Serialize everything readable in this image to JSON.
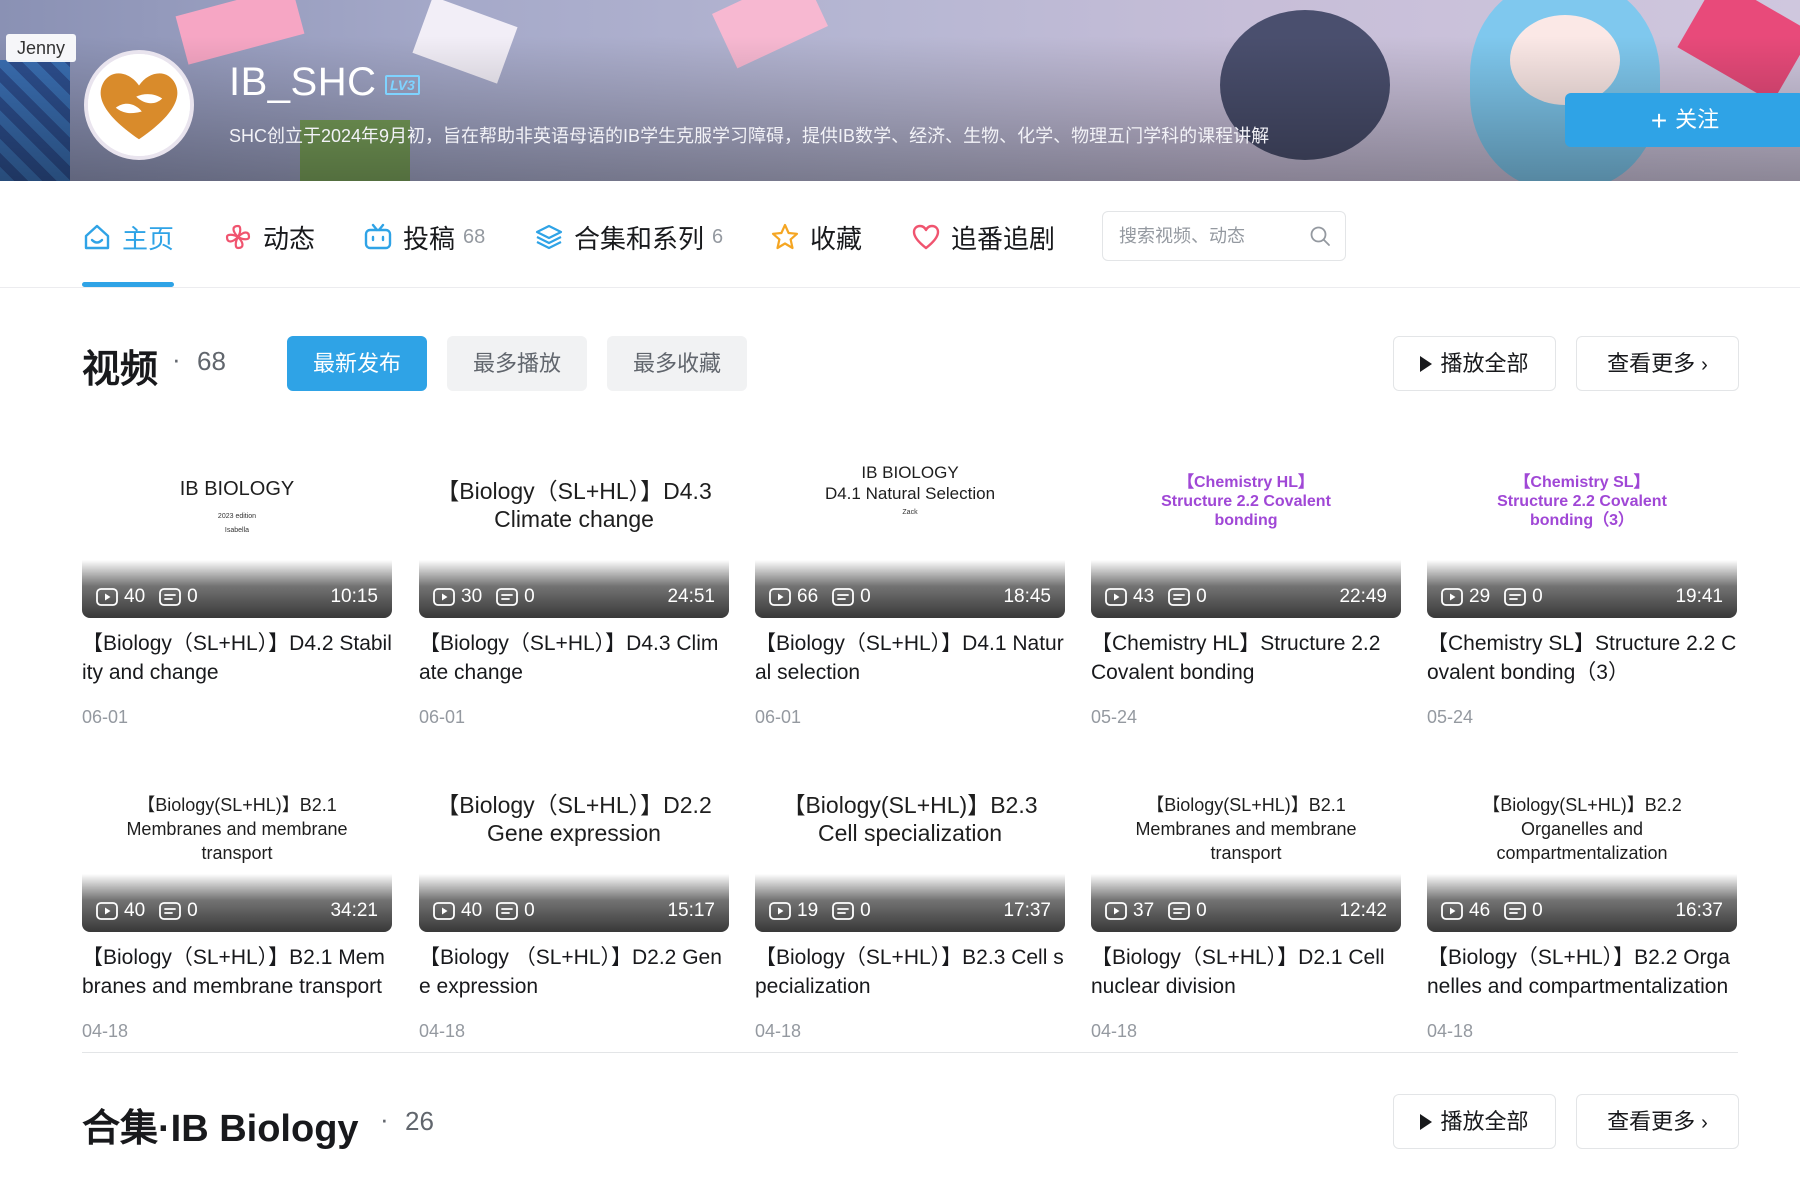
{
  "banner": {
    "badge": "Jenny",
    "username": "IB_SHC",
    "level": "LV3",
    "signature": "SHC创立于2024年9月初，旨在帮助非英语母语的IB学生克服学习障碍，提供IB数学、经济、生物、化学、物理五门学科的课程讲解",
    "follow_label": "关注"
  },
  "nav": {
    "items": [
      {
        "label": "主页",
        "count": ""
      },
      {
        "label": "动态",
        "count": ""
      },
      {
        "label": "投稿",
        "count": "68"
      },
      {
        "label": "合集和系列",
        "count": "6"
      },
      {
        "label": "收藏",
        "count": ""
      },
      {
        "label": "追番追剧",
        "count": ""
      }
    ],
    "search_placeholder": "搜索视频、动态"
  },
  "videos_section": {
    "title": "视频",
    "dot": "·",
    "count": "68",
    "sort": [
      "最新发布",
      "最多播放",
      "最多收藏"
    ],
    "play_all": "播放全部",
    "see_more": "查看更多"
  },
  "videos": [
    {
      "thumb_title": "IB  BIOLOGY",
      "thumb_sub": "2023 edition",
      "thumb_sub2": "Isabella",
      "plays": "40",
      "danmaku": "0",
      "duration": "10:15",
      "title": "【Biology（SL+HL）】D4.2 Stability and change",
      "date": "06-01"
    },
    {
      "thumb_title": "【Biology（SL+HL）】D4.3 Climate change",
      "plays": "30",
      "danmaku": "0",
      "duration": "24:51",
      "title": "【Biology（SL+HL）】D4.3 Climate change",
      "date": "06-01"
    },
    {
      "thumb_title": "IB BIOLOGY",
      "thumb_title2": "D4.1 Natural Selection",
      "thumb_sub": "Zack",
      "plays": "66",
      "danmaku": "0",
      "duration": "18:45",
      "title": "【Biology（SL+HL）】D4.1 Natural selection",
      "date": "06-01"
    },
    {
      "thumb_title": "【Chemistry HL】 Structure 2.2 Covalent bonding",
      "plays": "43",
      "danmaku": "0",
      "duration": "22:49",
      "title": "【Chemistry HL】Structure 2.2 Covalent bonding",
      "date": "05-24"
    },
    {
      "thumb_title": "【Chemistry SL】 Structure 2.2 Covalent bonding（3）",
      "plays": "29",
      "danmaku": "0",
      "duration": "19:41",
      "title": "【Chemistry SL】Structure 2.2 Covalent bonding（3）",
      "date": "05-24"
    },
    {
      "thumb_title": "【Biology(SL+HL)】B2.1 Membranes and membrane transport",
      "plays": "40",
      "danmaku": "0",
      "duration": "34:21",
      "title": "【Biology（SL+HL）】B2.1 Membranes and membrane transport",
      "date": "04-18"
    },
    {
      "thumb_title": "【Biology（SL+HL）】D2.2 Gene expression",
      "plays": "40",
      "danmaku": "0",
      "duration": "15:17",
      "title": "【Biology （SL+HL）】D2.2 Gene expression",
      "date": "04-18"
    },
    {
      "thumb_title": "【Biology(SL+HL)】B2.3 Cell specialization",
      "plays": "19",
      "danmaku": "0",
      "duration": "17:37",
      "title": "【Biology（SL+HL）】B2.3 Cell specialization",
      "date": "04-18"
    },
    {
      "thumb_title": "【Biology(SL+HL)】B2.1 Membranes and membrane transport",
      "plays": "37",
      "danmaku": "0",
      "duration": "12:42",
      "title": "【Biology（SL+HL）】D2.1 Cell nuclear division",
      "date": "04-18"
    },
    {
      "thumb_title": "【Biology(SL+HL)】B2.2 Organelles and compartmentalization",
      "plays": "46",
      "danmaku": "0",
      "duration": "16:37",
      "title": "【Biology（SL+HL）】B2.2 Organelles and compartmentalization",
      "date": "04-18"
    }
  ],
  "collection_section": {
    "title": "合集·IB Biology",
    "dot": "·",
    "count": "26",
    "play_all": "播放全部",
    "see_more": "查看更多"
  },
  "colors": {
    "accent": "#2fa3e6",
    "chem_purple": "#a047d6",
    "muted": "#9499a0"
  }
}
